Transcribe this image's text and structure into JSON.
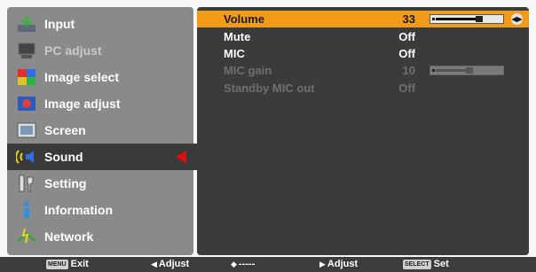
{
  "left_menu": {
    "items": [
      {
        "label": "Input",
        "icon": "input-icon",
        "state": "normal"
      },
      {
        "label": "PC adjust",
        "icon": "pc-adjust-icon",
        "state": "dim"
      },
      {
        "label": "Image select",
        "icon": "image-select-icon",
        "state": "normal"
      },
      {
        "label": "Image adjust",
        "icon": "image-adjust-icon",
        "state": "normal"
      },
      {
        "label": "Screen",
        "icon": "screen-icon",
        "state": "normal"
      },
      {
        "label": "Sound",
        "icon": "sound-icon",
        "state": "selected"
      },
      {
        "label": "Setting",
        "icon": "setting-icon",
        "state": "normal"
      },
      {
        "label": "Information",
        "icon": "information-icon",
        "state": "normal"
      },
      {
        "label": "Network",
        "icon": "network-icon",
        "state": "normal"
      }
    ]
  },
  "sound_panel": {
    "rows": [
      {
        "label": "Volume",
        "value": "33",
        "state": "highlight",
        "slider_level": 0.66
      },
      {
        "label": "Mute",
        "value": "Off",
        "state": "normal"
      },
      {
        "label": "MIC",
        "value": "Off",
        "state": "normal"
      },
      {
        "label": "MIC gain",
        "value": "10",
        "state": "dim",
        "slider_level": 0.5
      },
      {
        "label": "Standby MIC out",
        "value": "Off",
        "state": "dim"
      }
    ]
  },
  "status_bar": {
    "menu_key": "MENU",
    "exit_label": "Exit",
    "adjust_left_label": "Adjust",
    "updown_label": "-----",
    "adjust_right_label": "Adjust",
    "select_key": "SELECT",
    "set_label": "Set"
  },
  "colors": {
    "highlight": "#f29a1a",
    "selection_arrow": "#e01010",
    "left_panel": "#8a8a8a",
    "right_panel": "#3b3b3b"
  }
}
